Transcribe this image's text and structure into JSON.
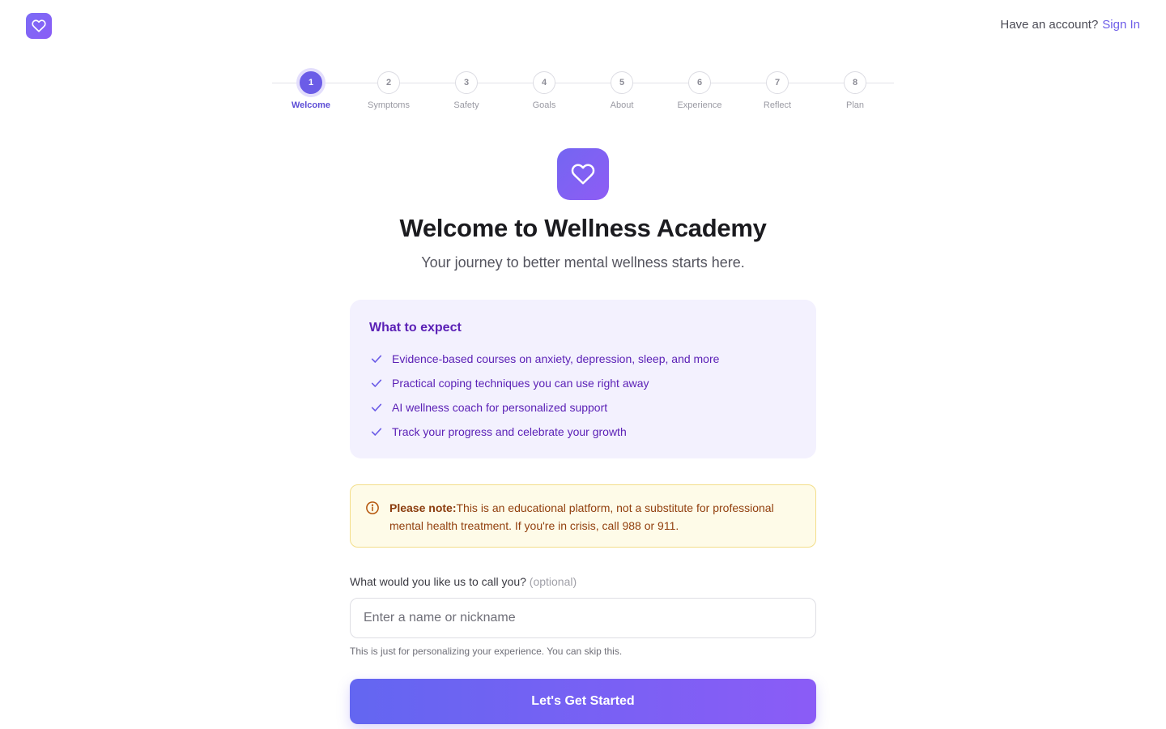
{
  "header": {
    "logo_icon": "heart-icon",
    "account_prompt": "Have an account?",
    "sign_in_label": "Sign In"
  },
  "stepper": {
    "current_step": 1,
    "steps": [
      {
        "number": "1",
        "label": "Welcome"
      },
      {
        "number": "2",
        "label": "Symptoms"
      },
      {
        "number": "3",
        "label": "Safety"
      },
      {
        "number": "4",
        "label": "Goals"
      },
      {
        "number": "5",
        "label": "About"
      },
      {
        "number": "6",
        "label": "Experience"
      },
      {
        "number": "7",
        "label": "Reflect"
      },
      {
        "number": "8",
        "label": "Plan"
      }
    ]
  },
  "hero": {
    "icon": "heart-icon",
    "title": "Welcome to Wellness Academy",
    "subtitle": "Your journey to better mental wellness starts here."
  },
  "expect": {
    "title": "What to expect",
    "items": [
      "Evidence-based courses on anxiety, depression, sleep, and more",
      "Practical coping techniques you can use right away",
      "AI wellness coach for personalized support",
      "Track your progress and celebrate your growth"
    ]
  },
  "note": {
    "icon": "info-icon",
    "label": "Please note:",
    "text": "This is an educational platform, not a substitute for professional mental health treatment. If you're in crisis, call 988 or 911."
  },
  "form": {
    "name_label": "What would you like us to call you?",
    "name_optional": "(optional)",
    "name_placeholder": "Enter a name or nickname",
    "name_value": "",
    "help_text": "This is just for personalizing your experience. You can skip this.",
    "submit_label": "Let's Get Started"
  },
  "colors": {
    "accent": "#6b5ce7",
    "accent_gradient_end": "#8b5cf6",
    "expect_background": "#f3f1fe",
    "expect_text": "#5b21b6",
    "note_background": "#fefbe8",
    "note_border": "#f3de8a",
    "note_text": "#92400e"
  }
}
